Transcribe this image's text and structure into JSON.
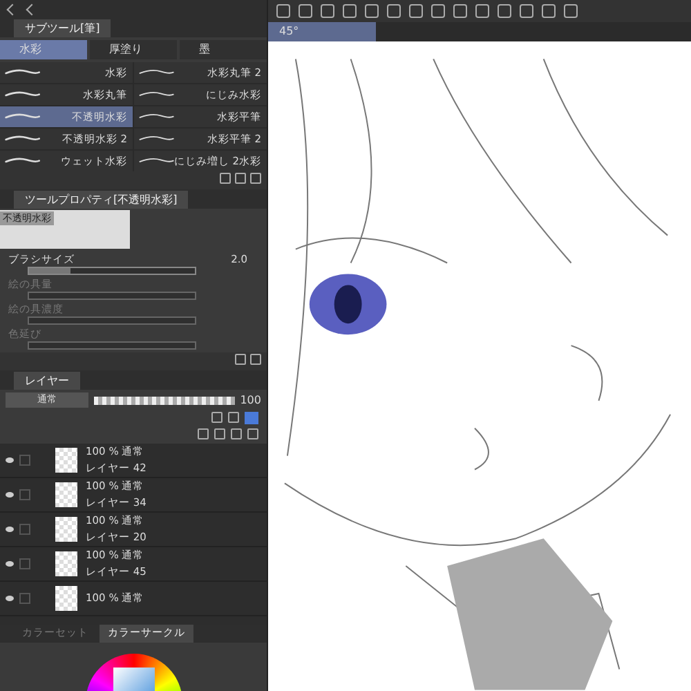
{
  "subtool_panel": {
    "title": "サブツール[筆]",
    "groups": [
      {
        "label": "水彩",
        "selected": true
      },
      {
        "label": "厚塗り",
        "selected": false
      },
      {
        "label": "墨",
        "selected": false
      }
    ],
    "brushes": [
      {
        "name": "水彩",
        "selected": false
      },
      {
        "name": "水彩丸筆 2",
        "selected": false
      },
      {
        "name": "水彩丸筆",
        "selected": false
      },
      {
        "name": "にじみ水彩",
        "selected": false
      },
      {
        "name": "不透明水彩",
        "selected": true
      },
      {
        "name": "水彩平筆",
        "selected": false
      },
      {
        "name": "不透明水彩 2",
        "selected": false
      },
      {
        "name": "水彩平筆 2",
        "selected": false
      },
      {
        "name": "ウェット水彩",
        "selected": false
      },
      {
        "name": "にじみ増し 2水彩",
        "selected": false
      }
    ]
  },
  "tool_property": {
    "title": "ツールプロパティ[不透明水彩]",
    "preview_label": "不透明水彩",
    "properties": [
      {
        "label": "ブラシサイズ",
        "value": "2.0",
        "level": 0.25,
        "disabled": false
      },
      {
        "label": "絵の具量",
        "disabled": true
      },
      {
        "label": "絵の具濃度",
        "disabled": true
      },
      {
        "label": "色延び",
        "disabled": true
      }
    ]
  },
  "layer_panel": {
    "title": "レイヤー",
    "blend_mode": "通常",
    "opacity": "100",
    "opacity_slider": {
      "level": 1
    },
    "layers": [
      {
        "info": "100 % 通常",
        "name": "レイヤー 42",
        "visible": true,
        "checked": false
      },
      {
        "info": "100 % 通常",
        "name": "レイヤー 34",
        "visible": true,
        "checked": false
      },
      {
        "info": "100 % 通常",
        "name": "レイヤー 20",
        "visible": true,
        "checked": false
      },
      {
        "info": "100 % 通常",
        "name": "レイヤー 45",
        "visible": true,
        "checked": false
      },
      {
        "info": "100 % 通常",
        "visible": true,
        "checked": false
      }
    ]
  },
  "color_tabs": [
    {
      "label": "カラーセット",
      "selected": false
    },
    {
      "label": "カラーサークル",
      "selected": true
    }
  ],
  "canvas": {
    "tab": "45°"
  }
}
